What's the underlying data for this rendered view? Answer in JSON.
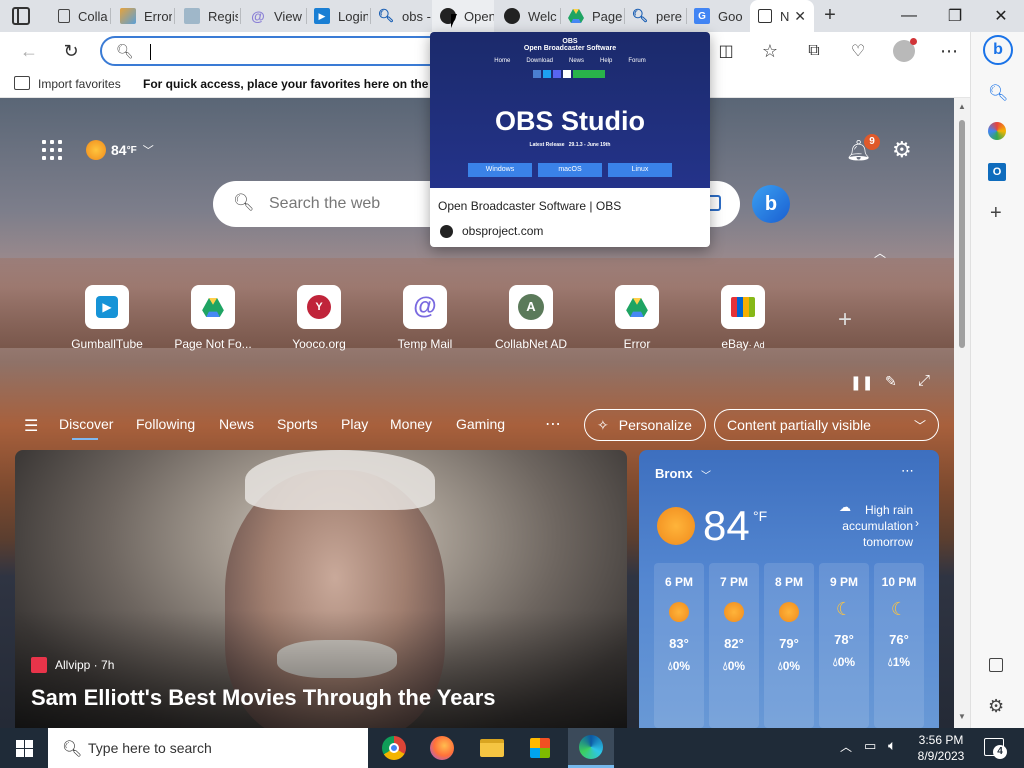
{
  "tabs": [
    {
      "label": "Colla",
      "icon": "page-icon"
    },
    {
      "label": "Error",
      "icon": "image-icon"
    },
    {
      "label": "Regis",
      "icon": "doc-icon"
    },
    {
      "label": "View",
      "icon": "at-icon"
    },
    {
      "label": "Login",
      "icon": "play-icon"
    },
    {
      "label": "obs -",
      "icon": "search-icon"
    },
    {
      "label": "Open",
      "icon": "obs-icon"
    },
    {
      "label": "Welc",
      "icon": "obs-icon"
    },
    {
      "label": "Page",
      "icon": "drive-icon"
    },
    {
      "label": "pere",
      "icon": "search-icon"
    },
    {
      "label": "Goo",
      "icon": "translate-icon"
    },
    {
      "label": "N",
      "icon": "newtab-icon"
    }
  ],
  "favorites_bar": {
    "import_label": "Import favorites",
    "hint": "For quick access, place your favorites here on the fav"
  },
  "tooltip": {
    "preview_brand": "OBS",
    "preview_subtitle": "Open Broadcaster Software",
    "preview_nav": [
      "Home",
      "Download",
      "News",
      "Help",
      "Forum"
    ],
    "preview_heading": "OBS Studio",
    "preview_release": "Latest Release",
    "preview_version": "29.1.3 - June 19th",
    "preview_buttons": [
      "Windows",
      "macOS",
      "Linux"
    ],
    "title": "Open Broadcaster Software | OBS",
    "url": "obsproject.com"
  },
  "header": {
    "temperature": "84",
    "temp_unit": "°F",
    "notification_count": "9"
  },
  "search": {
    "placeholder": "Search the web"
  },
  "quick_links": [
    {
      "label": "GumballTube",
      "icon": "play-icon"
    },
    {
      "label": "Page Not Fo...",
      "icon": "drive-icon"
    },
    {
      "label": "Yooco.org",
      "icon": "yooco-icon"
    },
    {
      "label": "Temp Mail",
      "icon": "at-icon"
    },
    {
      "label": "CollabNet AD",
      "icon": "A"
    },
    {
      "label": "Error",
      "icon": "drive-icon"
    },
    {
      "label": "eBay",
      "icon": "shopping-bag-icon",
      "badge": "· Ad"
    }
  ],
  "feed_nav": [
    "Discover",
    "Following",
    "News",
    "Sports",
    "Play",
    "Money",
    "Gaming"
  ],
  "personalize_label": "Personalize",
  "content_visibility": "Content partially visible",
  "news_card": {
    "source": "Allvipp · 7h",
    "headline": "Sam Elliott's Best Movies Through the Years"
  },
  "weather": {
    "location": "Bronx",
    "temperature": "84",
    "unit": "°F",
    "alert": "High rain accumulation tomorrow",
    "hours": [
      {
        "time": "6 PM",
        "icon": "sun-icon",
        "temp": "83°",
        "precip": "0%"
      },
      {
        "time": "7 PM",
        "icon": "sun-icon",
        "temp": "82°",
        "precip": "0%"
      },
      {
        "time": "8 PM",
        "icon": "sun-icon",
        "temp": "79°",
        "precip": "0%"
      },
      {
        "time": "9 PM",
        "icon": "moon-icon",
        "temp": "78°",
        "precip": "0%"
      },
      {
        "time": "10 PM",
        "icon": "moon-icon",
        "temp": "76°",
        "precip": "1%"
      }
    ]
  },
  "taskbar": {
    "search_placeholder": "Type here to search",
    "time": "3:56 PM",
    "date": "8/9/2023",
    "notification_count": "4"
  },
  "colors": {
    "accent": "#0078d4",
    "taskbar": "#1f2b38",
    "weather_card": "#4a7fcc"
  }
}
